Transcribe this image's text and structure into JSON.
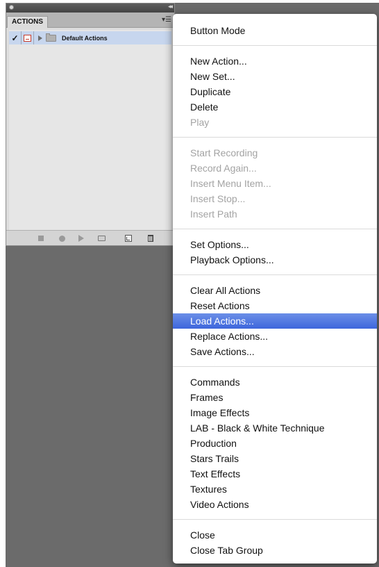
{
  "panel": {
    "tab_label": "ACTIONS",
    "action_set": {
      "name": "Default Actions",
      "checked": true
    }
  },
  "menu": {
    "highlight_color": "#3e66dc",
    "groups": [
      {
        "items": [
          {
            "label": "Button Mode",
            "enabled": true
          }
        ]
      },
      {
        "items": [
          {
            "label": "New Action...",
            "enabled": true
          },
          {
            "label": "New Set...",
            "enabled": true
          },
          {
            "label": "Duplicate",
            "enabled": true
          },
          {
            "label": "Delete",
            "enabled": true
          },
          {
            "label": "Play",
            "enabled": false
          }
        ]
      },
      {
        "items": [
          {
            "label": "Start Recording",
            "enabled": false
          },
          {
            "label": "Record Again...",
            "enabled": false
          },
          {
            "label": "Insert Menu Item...",
            "enabled": false
          },
          {
            "label": "Insert Stop...",
            "enabled": false
          },
          {
            "label": "Insert Path",
            "enabled": false
          }
        ]
      },
      {
        "items": [
          {
            "label": "Set Options...",
            "enabled": true
          },
          {
            "label": "Playback Options...",
            "enabled": true
          }
        ]
      },
      {
        "items": [
          {
            "label": "Clear All Actions",
            "enabled": true
          },
          {
            "label": "Reset Actions",
            "enabled": true
          },
          {
            "label": "Load Actions...",
            "enabled": true,
            "highlighted": true
          },
          {
            "label": "Replace Actions...",
            "enabled": true
          },
          {
            "label": "Save Actions...",
            "enabled": true
          }
        ]
      },
      {
        "items": [
          {
            "label": "Commands",
            "enabled": true
          },
          {
            "label": "Frames",
            "enabled": true
          },
          {
            "label": "Image Effects",
            "enabled": true
          },
          {
            "label": "LAB - Black & White Technique",
            "enabled": true
          },
          {
            "label": "Production",
            "enabled": true
          },
          {
            "label": "Stars Trails",
            "enabled": true
          },
          {
            "label": "Text Effects",
            "enabled": true
          },
          {
            "label": "Textures",
            "enabled": true
          },
          {
            "label": "Video Actions",
            "enabled": true
          }
        ]
      },
      {
        "items": [
          {
            "label": "Close",
            "enabled": true
          },
          {
            "label": "Close Tab Group",
            "enabled": true
          }
        ]
      }
    ]
  }
}
